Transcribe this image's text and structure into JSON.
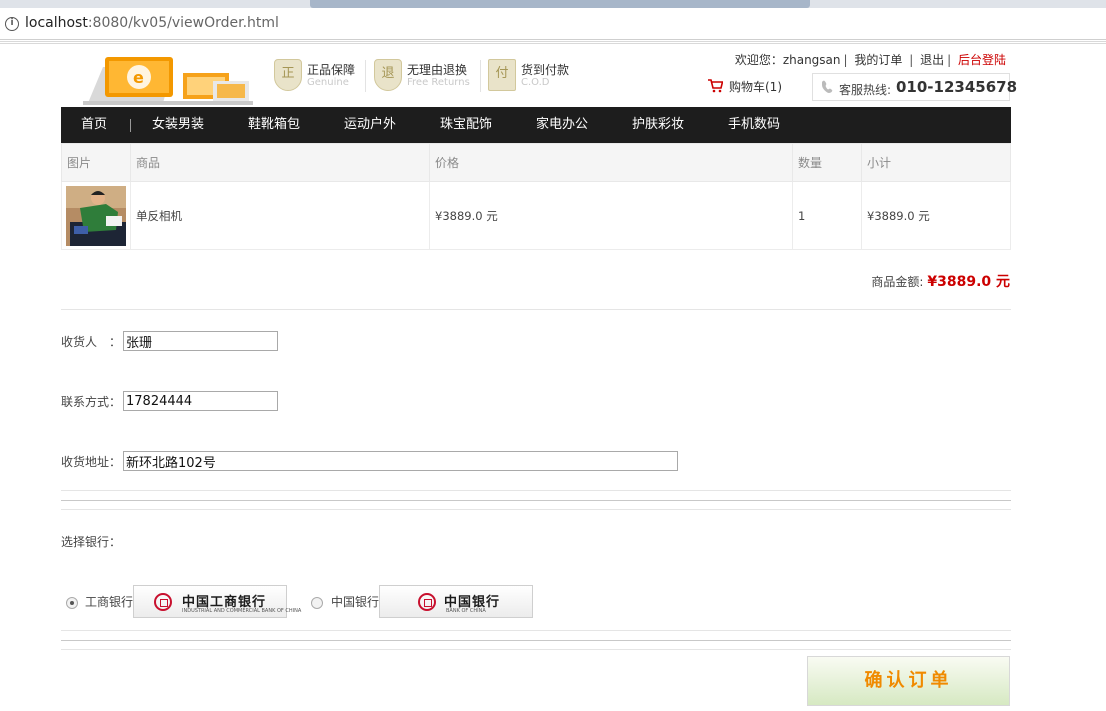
{
  "browser": {
    "url_host": "localhost",
    "url_rest": ":8080/kv05/viewOrder.html"
  },
  "header": {
    "badges": [
      {
        "title": "正品保障",
        "subtitle": "Genuine",
        "glyph": "正"
      },
      {
        "title": "无理由退换",
        "subtitle": "Free Returns",
        "glyph": "退"
      },
      {
        "title": "货到付款",
        "subtitle": "C.O.D",
        "glyph": "付"
      }
    ],
    "welcome": "欢迎您：zhangsan",
    "my_orders": "我的订单",
    "logout": "退出",
    "admin_login": "后台登陆",
    "cart": "购物车(1)",
    "hotline_label": "客服热线:",
    "hotline_number": "010-12345678"
  },
  "nav": [
    "首页",
    "女装男装",
    "鞋靴箱包",
    "运动户外",
    "珠宝配饰",
    "家电办公",
    "护肤彩妆",
    "手机数码"
  ],
  "order_table": {
    "headers": [
      "图片",
      "商品",
      "价格",
      "数量",
      "小计"
    ],
    "rows": [
      {
        "name": "单反相机",
        "price": "¥3889.0 元",
        "qty": "1",
        "subtotal": "¥3889.0 元"
      }
    ]
  },
  "total": {
    "label": "商品金额:",
    "amount": "¥3889.0 元"
  },
  "form": {
    "receiver_label": "收货人　：",
    "receiver_value": "张珊",
    "phone_label": "联系方式：",
    "phone_value": "17824444",
    "address_label": "收货地址：",
    "address_value": "新环北路102号"
  },
  "bank": {
    "label": "选择银行：",
    "options": [
      {
        "name": "工商银行",
        "logo_cn": "中国工商银行",
        "logo_en": "INDUSTRIAL AND COMMERCIAL BANK OF CHINA",
        "selected": true
      },
      {
        "name": "中国银行",
        "logo_cn": "中国银行",
        "logo_en": "BANK OF CHINA",
        "selected": false
      }
    ]
  },
  "confirm_button": "确认订单",
  "colors": {
    "nav_bg": "#1d1d1d",
    "price_red": "#cc0000",
    "confirm_text": "#f08a00",
    "admin_link": "#cc0000"
  }
}
